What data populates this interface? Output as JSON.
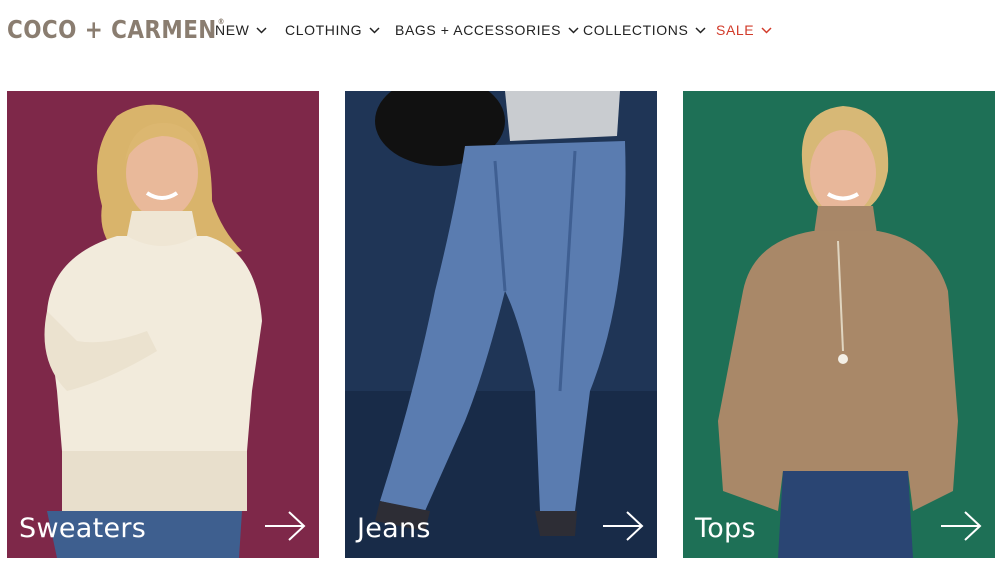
{
  "brand": {
    "name": "COCO + CARMEN",
    "mark": "®"
  },
  "nav": [
    {
      "label": "NEW"
    },
    {
      "label": "CLOTHING"
    },
    {
      "label": "BAGS + ACCESSORIES"
    },
    {
      "label": "COLLECTIONS"
    },
    {
      "label": "SALE"
    }
  ],
  "categories": [
    {
      "label": "Sweaters",
      "background": "#7e2849",
      "icon": "arrow-right-icon"
    },
    {
      "label": "Jeans",
      "background": "#1f3556",
      "icon": "arrow-right-icon"
    },
    {
      "label": "Tops",
      "background": "#1e7056",
      "icon": "arrow-right-icon"
    }
  ],
  "colors": {
    "sale": "#d23b2a",
    "logo": "#8a7d70",
    "nav_text": "#222222"
  }
}
